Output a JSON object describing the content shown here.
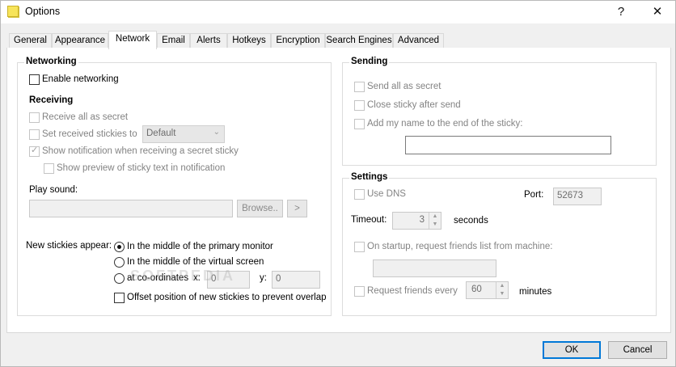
{
  "window": {
    "title": "Options",
    "help_label": "?",
    "close_label": "✕"
  },
  "tabs": [
    "General",
    "Appearance",
    "Network",
    "Email",
    "Alerts",
    "Hotkeys",
    "Encryption",
    "Search Engines",
    "Advanced"
  ],
  "active_tab": "Network",
  "networking": {
    "title": "Networking",
    "enable_label": "Enable networking",
    "enable_checked": false,
    "receiving_title": "Receiving",
    "receive_all_secret": "Receive all as secret",
    "set_received_label": "Set received stickies to",
    "set_received_value": "Default",
    "show_notification": "Show notification when receiving a secret sticky",
    "show_notification_checked": true,
    "show_preview": "Show preview of sticky text in notification",
    "play_sound_label": "Play sound:",
    "browse_label": "Browse..",
    "play_label": ">",
    "new_stickies_label": "New stickies appear:",
    "radio_primary": "In the middle of the primary monitor",
    "radio_virtual": "In the middle of the virtual screen",
    "radio_coords": "at co-ordinates",
    "radio_selected": "primary",
    "x_label": "x:",
    "x_value": "0",
    "y_label": "y:",
    "y_value": "0",
    "offset_label": "Offset position of new stickies to prevent overlap"
  },
  "sending": {
    "title": "Sending",
    "send_all_secret": "Send all as secret",
    "close_after_send": "Close sticky after send",
    "add_name": "Add my name to the end of the sticky:",
    "name_value": ""
  },
  "settings": {
    "title": "Settings",
    "use_dns": "Use DNS",
    "port_label": "Port:",
    "port_value": "52673",
    "timeout_label": "Timeout:",
    "timeout_value": "3",
    "timeout_unit": "seconds",
    "startup_request": "On startup, request friends list from machine:",
    "machine_value": "",
    "request_every": "Request friends every",
    "request_value": "60",
    "request_unit": "minutes"
  },
  "footer": {
    "ok_label": "OK",
    "cancel_label": "Cancel"
  },
  "watermark": "SOFTPEDIA"
}
